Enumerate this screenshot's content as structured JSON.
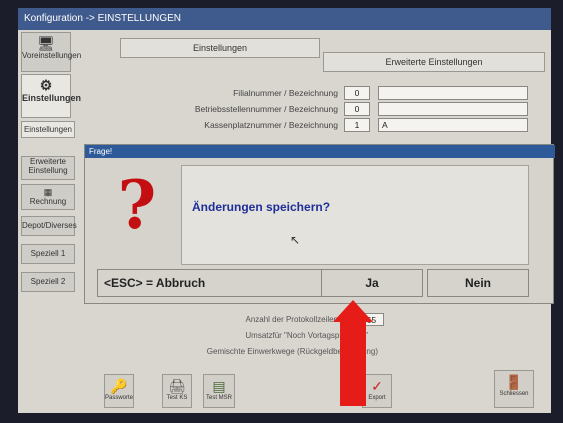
{
  "window": {
    "title": "Konfiguration -> EINSTELLUNGEN"
  },
  "sidebar": {
    "items": [
      {
        "label": "Voreinstellungen",
        "icon": "computer-icon"
      },
      {
        "label": "Einstellungen",
        "icon": "settings-icon"
      }
    ],
    "subitems": [
      "Einstellungen",
      "Erweiterte Einstellung",
      "Rechnung",
      "Depot/Diverses",
      "Speziell 1",
      "Speziell 2"
    ]
  },
  "tabs": [
    "Einstellungen",
    "Erweiterte Einstellungen"
  ],
  "fields": [
    {
      "label": "Filialnummer / Bezeichnung",
      "value": "0",
      "text": ""
    },
    {
      "label": "Betriebsstellennummer / Bezeichnung",
      "value": "0",
      "text": ""
    },
    {
      "label": "Kassenplatznummer / Bezeichnung",
      "value": "1",
      "text": "A"
    }
  ],
  "dialog": {
    "title": "Frage!",
    "message": "Änderungen speichern?",
    "buttons": {
      "abort": "<ESC> = Abbruch",
      "yes": "Ja",
      "no": "Nein"
    }
  },
  "lower_fields": [
    {
      "label": "Anzahl der Protokollzeilen",
      "value": "365"
    },
    {
      "label": "Umsatzfür \"Noch Vortagsprotokoll\"",
      "value": ""
    },
    {
      "label": "Gemischte Einwerkwege (Rückgeldberechnung)",
      "value": ""
    }
  ],
  "toolbar": {
    "items": [
      {
        "label": "Passworte",
        "icon": "key-icon"
      },
      {
        "label": "Test KS",
        "icon": "printer-icon"
      },
      {
        "label": "Test MSR",
        "icon": "card-reader-icon"
      },
      {
        "label": "Export",
        "icon": "export-icon"
      },
      {
        "label": "Schliessen",
        "icon": "exit-door-icon"
      }
    ]
  },
  "colors": {
    "titlebar": "#3f5a8c",
    "dialog_title": "#2e5a9a",
    "question_mark": "#c40f12",
    "message": "#1e2f9a",
    "arrow": "#e51c18"
  }
}
